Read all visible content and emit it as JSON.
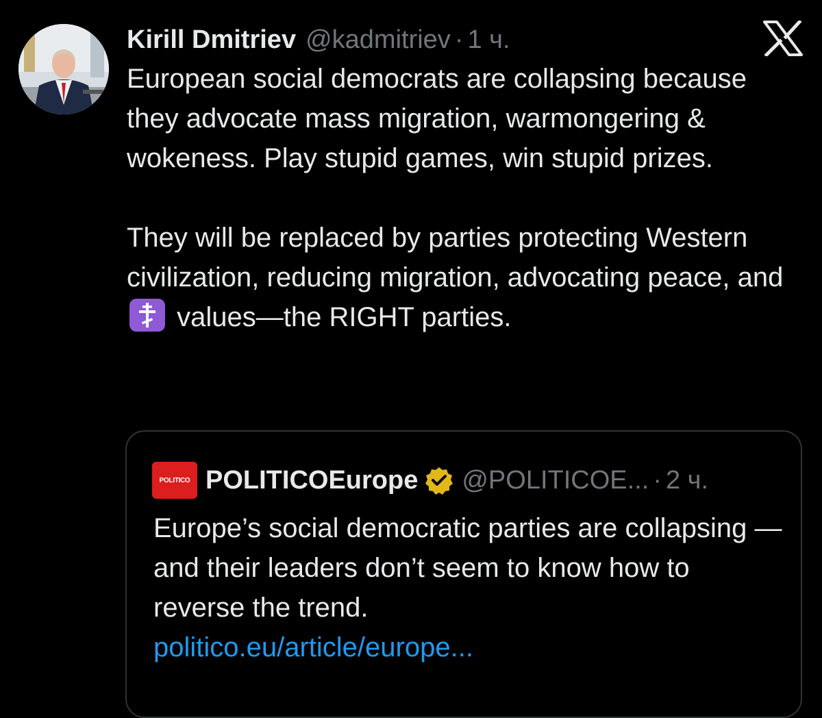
{
  "author": {
    "name": "Kirill Dmitriev",
    "handle": "@kadmitriev",
    "separator": "·",
    "time": "1 ч."
  },
  "tweet": {
    "para1": "European social democrats are collapsing because they advocate mass migration, warmongering & wokeness. Play stupid games, win stupid prizes.",
    "para2_before": "They will be replaced by parties protecting Western civilization, reducing migration, advocating peace, and",
    "para2_after": "values—the RIGHT parties.",
    "emoji": "orthodox-cross-emoji"
  },
  "quoted": {
    "logo_text": "POLITICO",
    "name": "POLITICOEurope",
    "verified_icon": "verified-badge-gold-icon",
    "handle": "@POLITICOE...",
    "separator": "·",
    "time": "2 ч.",
    "text": "Europe’s social democratic parties are collapsing — and their leaders don’t seem to know how to reverse the trend.",
    "link": "politico.eu/article/europe..."
  },
  "icons": {
    "platform": "x-logo-icon",
    "accent": "#1d9bf0",
    "verified_color": "#e2b719",
    "logo_bg": "#dc1e1e"
  }
}
